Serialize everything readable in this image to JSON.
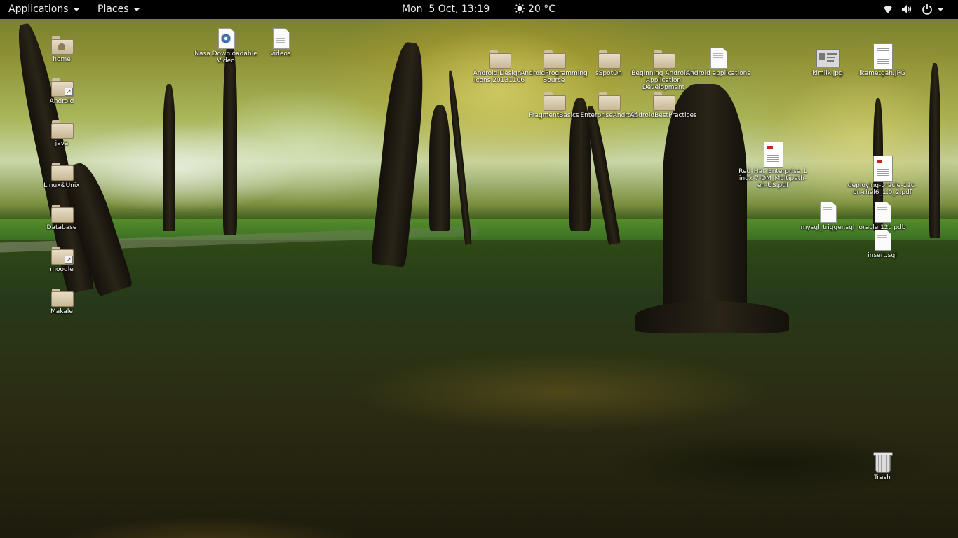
{
  "top_bar": {
    "applications_label": "Applications",
    "places_label": "Places",
    "clock": "Mon  5 Oct, 13:19",
    "weather": "20 °C",
    "icons": {
      "weather": "sun-icon",
      "network": "wifi-icon",
      "volume": "volume-icon",
      "power": "power-icon"
    }
  },
  "desktop": {
    "icons": [
      {
        "label": "home",
        "type": "folder",
        "icon": "home-folder-icon"
      },
      {
        "label": "Android",
        "type": "folder-link",
        "icon": "folder-link-icon"
      },
      {
        "label": "java",
        "type": "folder",
        "icon": "folder-icon"
      },
      {
        "label": "Linux&Unix",
        "type": "folder",
        "icon": "folder-icon"
      },
      {
        "label": "Database",
        "type": "folder",
        "icon": "folder-icon"
      },
      {
        "label": "moodle",
        "type": "folder-link",
        "icon": "folder-link-icon"
      },
      {
        "label": "Makale",
        "type": "folder",
        "icon": "folder-icon"
      },
      {
        "label": "Nasa Downloadable Video",
        "type": "video",
        "icon": "video-file-icon"
      },
      {
        "label": "videos",
        "type": "text",
        "icon": "text-file-icon"
      },
      {
        "label": "Android Design - Icons 20131106",
        "type": "folder",
        "icon": "folder-icon"
      },
      {
        "label": "AndroidProgrammingSource",
        "type": "folder",
        "icon": "folder-icon"
      },
      {
        "label": "sSpotOn",
        "type": "folder",
        "icon": "folder-icon"
      },
      {
        "label": "Beginning Android 4 Application Development",
        "type": "folder",
        "icon": "folder-icon"
      },
      {
        "label": "Android applications",
        "type": "text",
        "icon": "text-file-icon"
      },
      {
        "label": "FragmentBasics",
        "type": "folder",
        "icon": "folder-icon"
      },
      {
        "label": "EnterpriseAndroid",
        "type": "folder",
        "icon": "folder-icon"
      },
      {
        "label": "AndroidBestPractices",
        "type": "folder",
        "icon": "folder-icon"
      },
      {
        "label": "kimlik.jpg",
        "type": "image",
        "icon": "image-file-icon"
      },
      {
        "label": "ikametgah.JPG",
        "type": "image",
        "icon": "image-file-icon"
      },
      {
        "label": "Red_Hat_Enterprise_Linux-7-DM_Multipath-en-US.pdf",
        "type": "pdf",
        "icon": "pdf-file-icon"
      },
      {
        "label": "deploying-oracle-12c-on-rhel6_1.0_2.pdf",
        "type": "pdf",
        "icon": "pdf-file-icon"
      },
      {
        "label": "mysql_trigger.sql",
        "type": "text",
        "icon": "text-file-icon"
      },
      {
        "label": "oracle 12c pdb",
        "type": "text",
        "icon": "text-file-icon"
      },
      {
        "label": "insert.sql",
        "type": "text",
        "icon": "text-file-icon"
      },
      {
        "label": "Trash",
        "type": "trash",
        "icon": "trash-icon"
      }
    ]
  }
}
